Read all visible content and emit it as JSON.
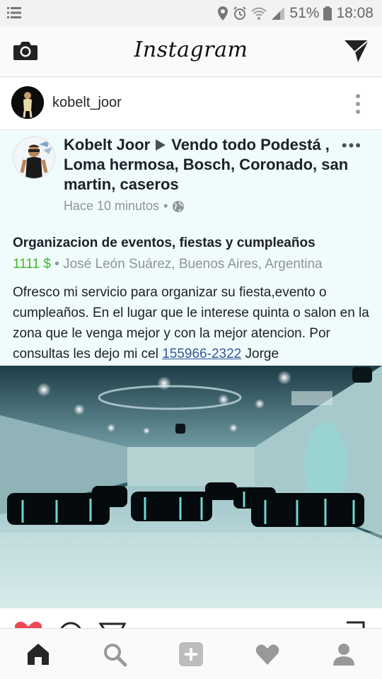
{
  "status_bar": {
    "battery": "51%",
    "time": "18:08"
  },
  "app_bar": {
    "title": "Instagram",
    "left_icon": "camera-icon",
    "right_icon": "direct-send-icon"
  },
  "user_row": {
    "username": "kobelt_joor"
  },
  "post": {
    "author": "Kobelt Joor",
    "group": "Vendo todo Podestá , Loma hermosa, Bosch, Coronado, san martin, caseros",
    "time": "Hace 10 minutos",
    "time_separator": "•",
    "heading": "Organizacion de eventos, fiestas y cumpleaños",
    "price": "1111 $",
    "location": "• José León Suárez, Buenos Aires, Argentina",
    "body_text": "Ofresco mi servicio para organizar su fiesta,evento o cumpleaños. En el lugar que le interese quinta o salon en la zona que le venga mejor y con la mejor atencion. Por consultas les dejo mi cel ",
    "phone": "155966-2322",
    "signature": " Jorge"
  },
  "photo": {
    "subject": "event-hall-photo"
  },
  "bottom_nav": {
    "items": [
      "home-icon",
      "search-icon",
      "add-icon",
      "heart-icon",
      "profile-icon"
    ]
  },
  "colors": {
    "price_green": "#42b72a",
    "link_blue": "#365899",
    "post_bg": "#f0fbfb",
    "like_red": "#ed4956"
  }
}
